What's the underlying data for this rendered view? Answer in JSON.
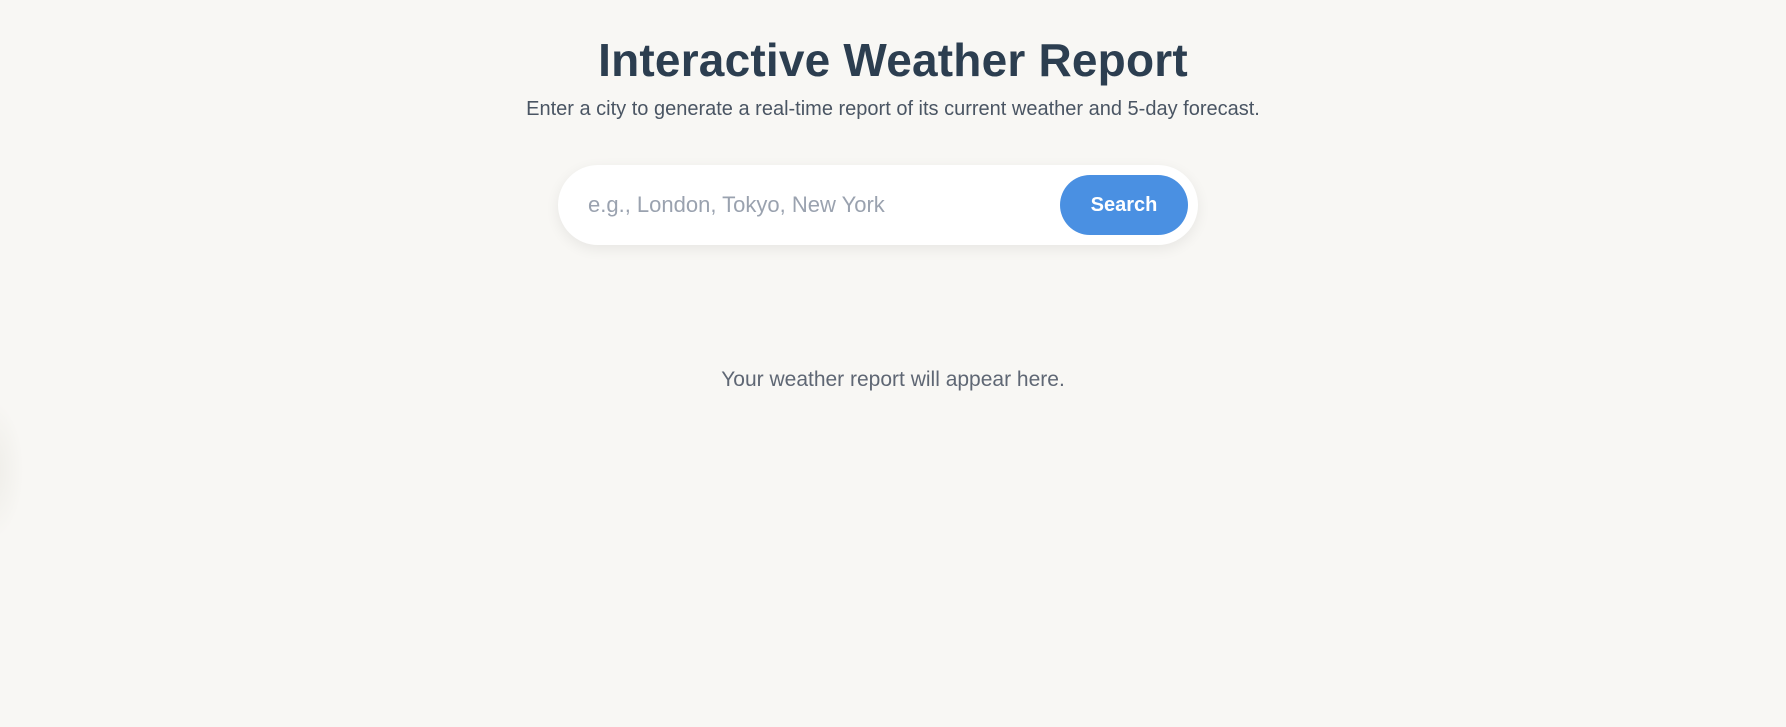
{
  "header": {
    "title": "Interactive Weather Report",
    "subtitle": "Enter a city to generate a real-time report of its current weather and 5-day forecast."
  },
  "search": {
    "value": "",
    "placeholder": "e.g., London, Tokyo, New York",
    "button_label": "Search"
  },
  "report": {
    "placeholder_text": "Your weather report will appear here."
  },
  "colors": {
    "background": "#f8f7f4",
    "title": "#2c3e50",
    "accent": "#4a90e2",
    "button_text": "#ffffff",
    "muted_text": "#5f6774"
  }
}
